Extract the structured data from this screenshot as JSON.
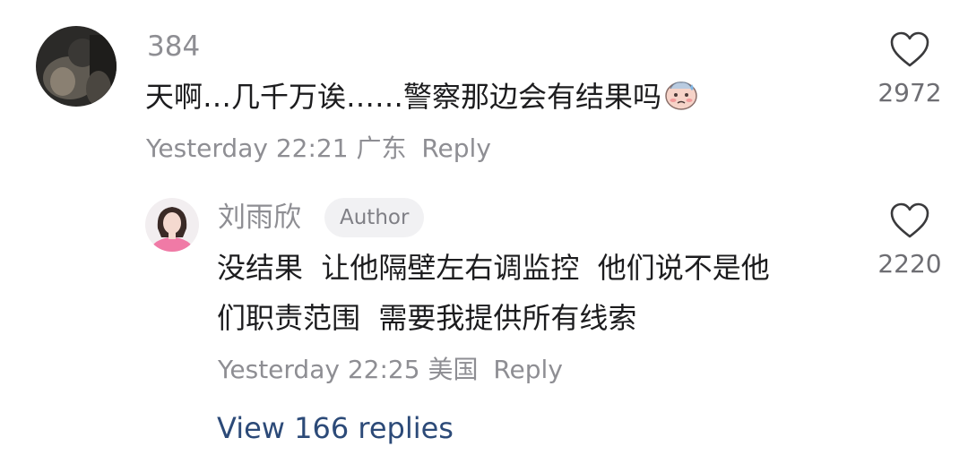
{
  "comment": {
    "username": "384",
    "text": "天啊…几千万诶……警察那边会有结果吗",
    "emoji": "pleading-sweat-face-emoji",
    "time": "Yesterday 22:21",
    "location": "广东",
    "reply_label": "Reply",
    "like_count": "2972"
  },
  "reply": {
    "username": "刘雨欣",
    "badge": "Author",
    "text_line1": "没结果  让他隔壁左右调监控  他们说不是他",
    "text_line2": "们职责范围  需要我提供所有线索",
    "time": "Yesterday 22:25",
    "location": "美国",
    "reply_label": "Reply",
    "like_count": "2220"
  },
  "view_replies": "View 166 replies",
  "colors": {
    "text": "#1c1c1e",
    "meta": "#8e8e93",
    "link": "#2c4a78",
    "badge_bg": "#f1f1f3"
  }
}
